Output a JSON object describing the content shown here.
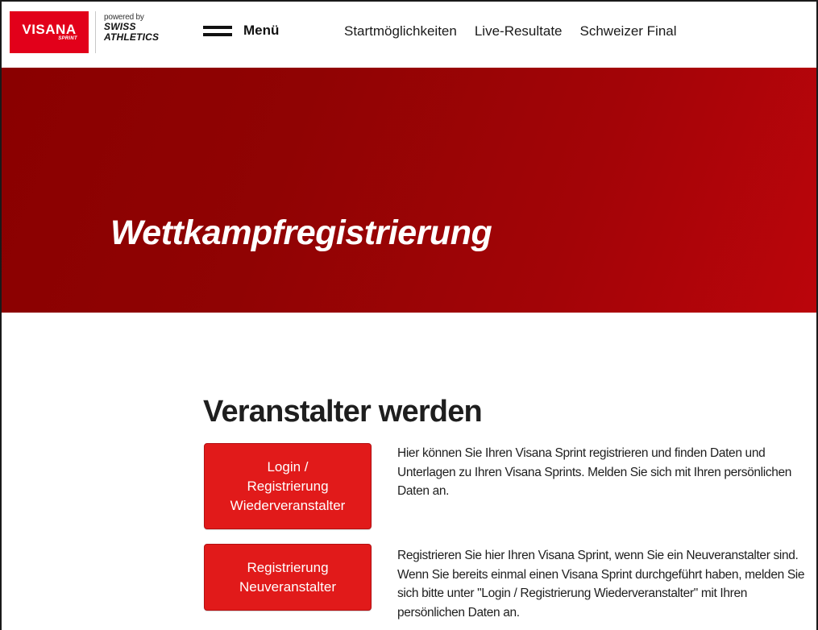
{
  "header": {
    "logo": {
      "brand": "VISANA",
      "sub": "SPRINT"
    },
    "powered_by": {
      "prefix": "powered by",
      "line1": "SWISS",
      "line2": "ATHLETICS"
    },
    "menu_label": "Menü",
    "nav": [
      {
        "label": "Startmöglichkeiten"
      },
      {
        "label": "Live-Resultate"
      },
      {
        "label": "Schweizer Final"
      }
    ]
  },
  "hero": {
    "title": "Wettkampfregistrierung"
  },
  "main": {
    "section_title": "Veranstalter werden",
    "items": [
      {
        "button_label_lines": [
          "Login /",
          "Registrierung",
          "Wiederveranstalter"
        ],
        "description": "Hier können Sie Ihren Visana Sprint registrieren und finden Daten und Unterlagen zu Ihren Visana Sprints. Melden Sie sich mit Ihren persönlichen Daten an."
      },
      {
        "button_label_lines": [
          "Registrierung",
          "Neuveranstalter"
        ],
        "description": "Registrieren Sie hier Ihren Visana Sprint, wenn Sie ein Neuveranstalter sind. Wenn Sie bereits einmal einen Visana Sprint durchgeführt haben, melden Sie sich bitte unter \"Login / Registrierung Wiederveranstalter\" mit Ihren persönlichen Daten an."
      }
    ]
  },
  "colors": {
    "brand_red": "#e2001a",
    "hero_dark": "#8a0000",
    "hero_light": "#bb050b",
    "button_red": "#e11a1a"
  },
  "icons": {
    "menu": "hamburger-icon"
  }
}
